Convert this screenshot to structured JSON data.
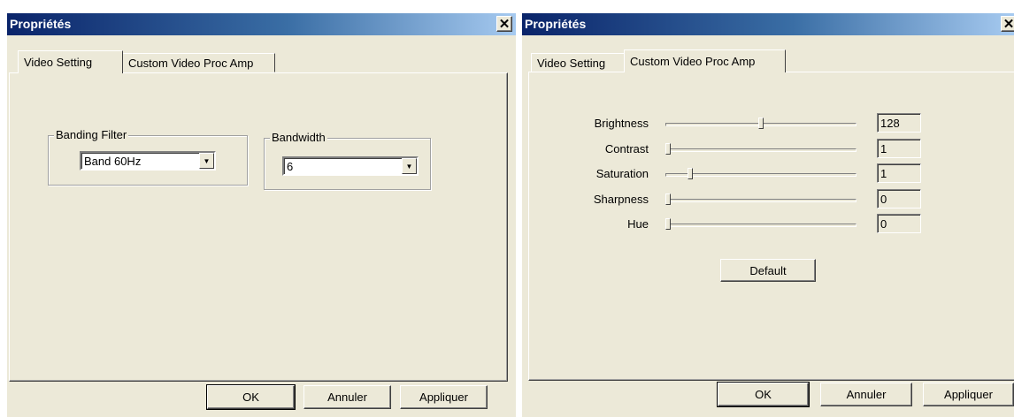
{
  "left_dialog": {
    "title": "Propriétés",
    "close_glyph": "✕",
    "tabs": [
      {
        "label": "Video Setting",
        "active": true
      },
      {
        "label": "Custom Video Proc Amp",
        "active": false
      }
    ],
    "banding_filter": {
      "label": "Banding Filter",
      "value": "Band 60Hz"
    },
    "bandwidth": {
      "label": "Bandwidth",
      "value": "6"
    },
    "buttons": {
      "ok": "OK",
      "cancel": "Annuler",
      "apply": "Appliquer"
    }
  },
  "right_dialog": {
    "title": "Propriétés",
    "close_glyph": "✕",
    "tabs": [
      {
        "label": "Video Setting",
        "active": false
      },
      {
        "label": "Custom Video Proc Amp",
        "active": true
      }
    ],
    "sliders": [
      {
        "label": "Brightness",
        "value": "128",
        "fraction": 0.5
      },
      {
        "label": "Contrast",
        "value": "1",
        "fraction": 0.0
      },
      {
        "label": "Saturation",
        "value": "1",
        "fraction": 0.12
      },
      {
        "label": "Sharpness",
        "value": "0",
        "fraction": 0.0
      },
      {
        "label": "Hue",
        "value": "0",
        "fraction": 0.0
      }
    ],
    "default_button": "Default",
    "buttons": {
      "ok": "OK",
      "cancel": "Annuler",
      "apply": "Appliquer"
    }
  },
  "arrow_glyph": "▼"
}
